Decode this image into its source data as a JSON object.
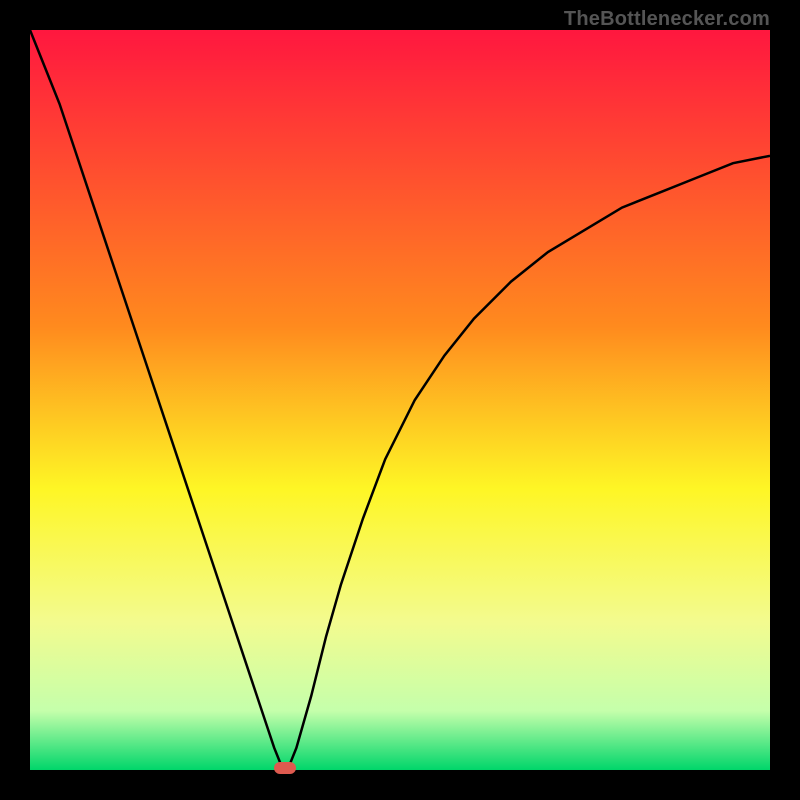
{
  "watermark": "TheBottlenecker.com",
  "colors": {
    "frame": "#000000",
    "red_top": "#ff173f",
    "orange": "#ffb21e",
    "yellow": "#fef625",
    "yellow_green": "#e8fb6a",
    "pale_green": "#c5ffab",
    "green_bottom": "#00d66a",
    "curve": "#000000",
    "marker": "#de5a4f"
  },
  "chart_data": {
    "type": "line",
    "title": "",
    "xlabel": "",
    "ylabel": "",
    "xlim": [
      0,
      100
    ],
    "ylim": [
      0,
      100
    ],
    "curve": {
      "x": [
        0,
        2,
        4,
        6,
        8,
        10,
        12,
        14,
        16,
        18,
        20,
        22,
        24,
        26,
        28,
        30,
        32,
        33,
        34,
        35,
        36,
        38,
        40,
        42,
        45,
        48,
        52,
        56,
        60,
        65,
        70,
        75,
        80,
        85,
        90,
        95,
        100
      ],
      "y": [
        100,
        95,
        90,
        84,
        78,
        72,
        66,
        60,
        54,
        48,
        42,
        36,
        30,
        24,
        18,
        12,
        6,
        3,
        0.5,
        0.5,
        3,
        10,
        18,
        25,
        34,
        42,
        50,
        56,
        61,
        66,
        70,
        73,
        76,
        78,
        80,
        82,
        83
      ]
    },
    "marker": {
      "x": 34.5,
      "y": 0
    },
    "background_gradient": [
      {
        "stop": 0.0,
        "color": "#ff173f"
      },
      {
        "stop": 0.4,
        "color": "#ff8a1e"
      },
      {
        "stop": 0.62,
        "color": "#fef625"
      },
      {
        "stop": 0.8,
        "color": "#f3fb8f"
      },
      {
        "stop": 0.92,
        "color": "#c5ffab"
      },
      {
        "stop": 1.0,
        "color": "#00d66a"
      }
    ]
  }
}
